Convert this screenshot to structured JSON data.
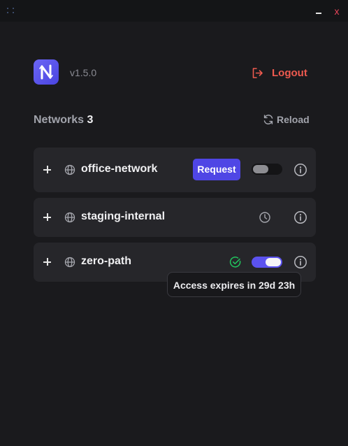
{
  "app": {
    "version": "v1.5.0",
    "logout_label": "Logout"
  },
  "window": {
    "close_glyph": "x"
  },
  "networks": {
    "title": "Networks",
    "count": "3",
    "reload_label": "Reload",
    "items": [
      {
        "name": "office-network",
        "action_label": "Request",
        "toggle_enabled": false
      },
      {
        "name": "staging-internal",
        "status": "pending",
        "status_icon": "clock-icon"
      },
      {
        "name": "zero-path",
        "status": "active",
        "status_icon": "check-circle-icon",
        "toggle_enabled": true,
        "tooltip": "Access expires in 29d 23h"
      }
    ]
  },
  "colors": {
    "accent": "#4f46e5",
    "logout": "#ee5a4f",
    "success": "#22c55e",
    "close": "#e8455a"
  }
}
